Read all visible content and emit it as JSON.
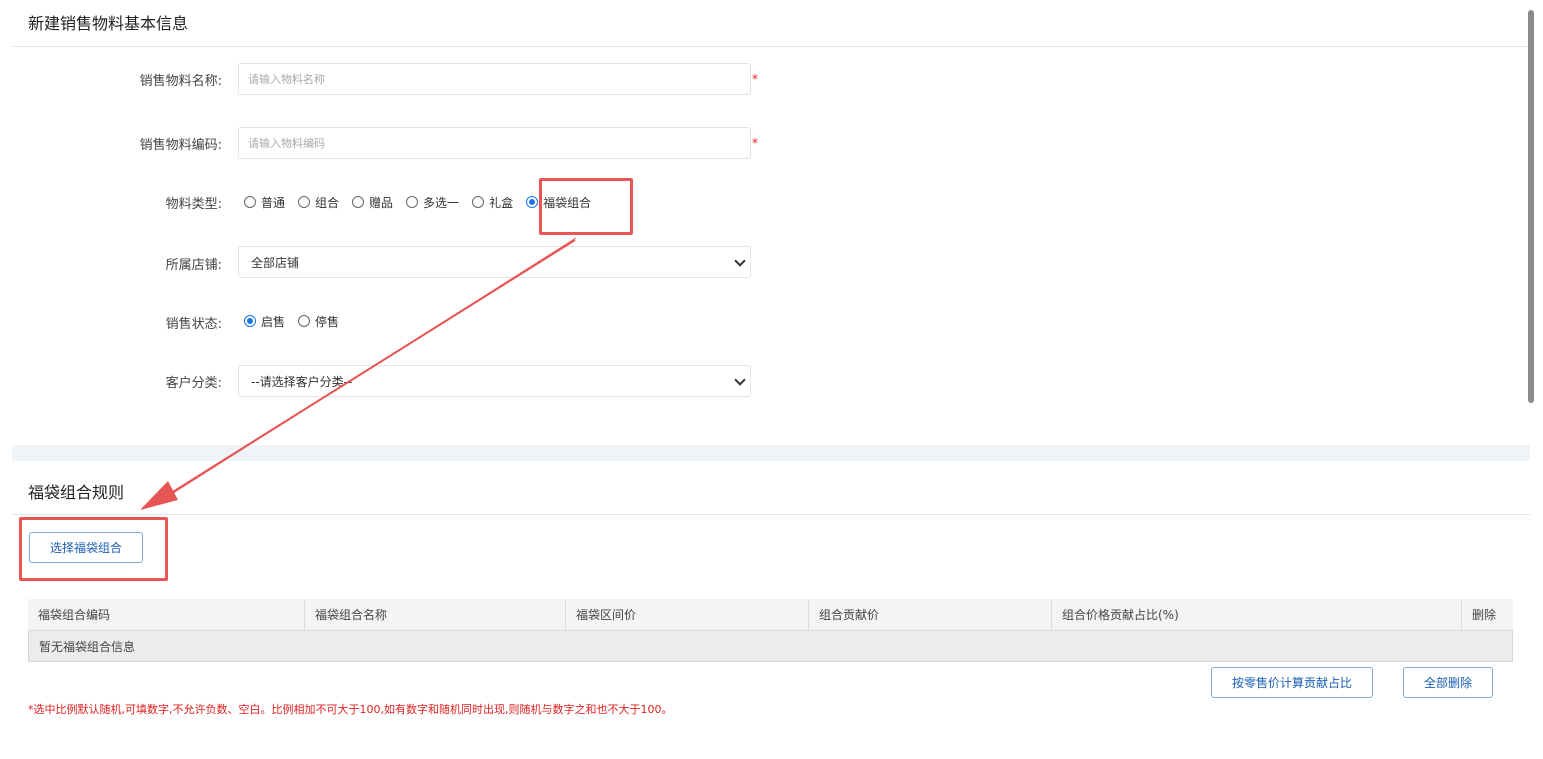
{
  "basic_info": {
    "title": "新建销售物料基本信息",
    "name_label": "销售物料名称:",
    "name_placeholder": "请输入物料名称",
    "code_label": "销售物料编码:",
    "code_placeholder": "请输入物料编码",
    "required_mark": "*",
    "type_label": "物料类型:",
    "type_options": [
      "普通",
      "组合",
      "赠品",
      "多选一",
      "礼盒",
      "福袋组合"
    ],
    "type_selected": "福袋组合",
    "store_label": "所属店铺:",
    "store_value": "全部店铺",
    "status_label": "销售状态:",
    "status_options": [
      "启售",
      "停售"
    ],
    "status_selected": "启售",
    "customer_label": "客户分类:",
    "customer_value": "--请选择客户分类--"
  },
  "lucky_bag": {
    "title": "福袋组合规则",
    "select_button": "选择福袋组合",
    "table_headers": [
      "福袋组合编码",
      "福袋组合名称",
      "福袋区间价",
      "组合贡献价",
      "组合价格贡献占比(%)",
      "删除"
    ],
    "empty_text": "暂无福袋组合信息",
    "calc_button": "按零售价计算贡献占比",
    "delete_all_button": "全部删除",
    "note": "*选中比例默认随机,可填数字,不允许负数、空白。比例相加不可大于100,如有数字和随机同时出现,则随机与数字之和也不大于100。"
  },
  "colors": {
    "annotation": "#e85555",
    "accent": "#1a73e8",
    "required": "#e02020"
  }
}
